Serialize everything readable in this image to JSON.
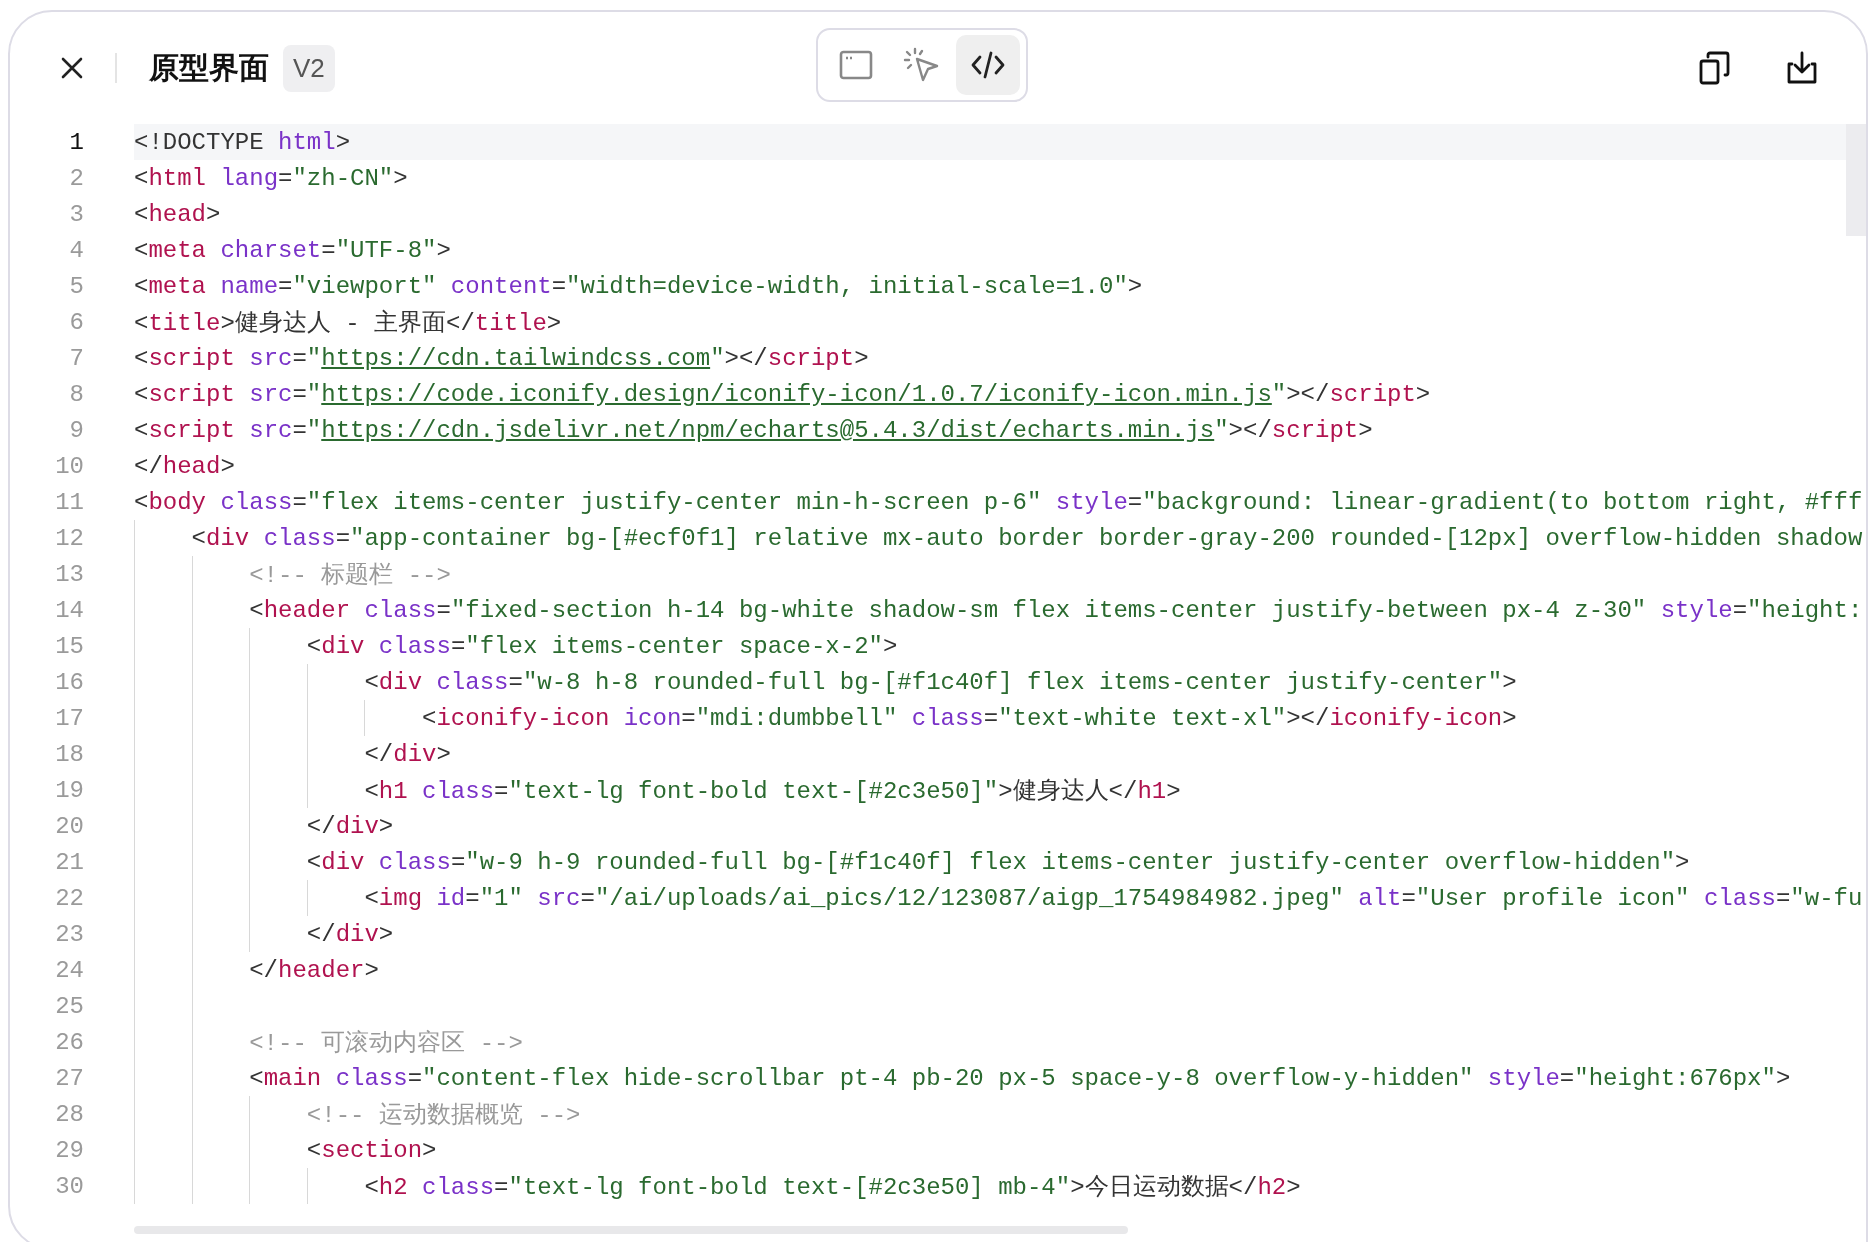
{
  "header": {
    "title": "原型界面",
    "version": "V2",
    "view_modes": [
      {
        "kind": "preview",
        "selected": false
      },
      {
        "kind": "select",
        "selected": false
      },
      {
        "kind": "code",
        "selected": true
      }
    ]
  },
  "editor": {
    "lines": [
      {
        "number": "1",
        "selected": true,
        "tokens": [
          {
            "kind": "punct",
            "text": "<!DOCTYPE"
          },
          {
            "kind": "attr",
            "text": " html"
          },
          {
            "kind": "punct",
            "text": ">"
          }
        ]
      },
      {
        "number": "2",
        "selected": false,
        "tokens": [
          {
            "kind": "punct",
            "text": "<"
          },
          {
            "kind": "tag",
            "text": "html"
          },
          {
            "kind": "attr",
            "text": " lang"
          },
          {
            "kind": "punct",
            "text": "="
          },
          {
            "kind": "string",
            "text": "\"zh-CN\""
          },
          {
            "kind": "punct",
            "text": ">"
          }
        ]
      },
      {
        "number": "3",
        "selected": false,
        "tokens": [
          {
            "kind": "punct",
            "text": "<"
          },
          {
            "kind": "tag",
            "text": "head"
          },
          {
            "kind": "punct",
            "text": ">"
          }
        ]
      },
      {
        "number": "4",
        "selected": false,
        "tokens": [
          {
            "kind": "punct",
            "text": "<"
          },
          {
            "kind": "tag",
            "text": "meta"
          },
          {
            "kind": "attr",
            "text": " charset"
          },
          {
            "kind": "punct",
            "text": "="
          },
          {
            "kind": "string",
            "text": "\"UTF-8\""
          },
          {
            "kind": "punct",
            "text": ">"
          }
        ]
      },
      {
        "number": "5",
        "selected": false,
        "tokens": [
          {
            "kind": "punct",
            "text": "<"
          },
          {
            "kind": "tag",
            "text": "meta"
          },
          {
            "kind": "attr",
            "text": " name"
          },
          {
            "kind": "punct",
            "text": "="
          },
          {
            "kind": "string",
            "text": "\"viewport\""
          },
          {
            "kind": "attr",
            "text": " content"
          },
          {
            "kind": "punct",
            "text": "="
          },
          {
            "kind": "string",
            "text": "\"width=device-width, initial-scale=1.0\""
          },
          {
            "kind": "punct",
            "text": ">"
          }
        ]
      },
      {
        "number": "6",
        "selected": false,
        "tokens": [
          {
            "kind": "punct",
            "text": "<"
          },
          {
            "kind": "tag",
            "text": "title"
          },
          {
            "kind": "punct",
            "text": ">健身达人 - 主界面</"
          },
          {
            "kind": "tag",
            "text": "title"
          },
          {
            "kind": "punct",
            "text": ">"
          }
        ]
      },
      {
        "number": "7",
        "selected": false,
        "tokens": [
          {
            "kind": "punct",
            "text": "<"
          },
          {
            "kind": "tag",
            "text": "script"
          },
          {
            "kind": "attr",
            "text": " src"
          },
          {
            "kind": "punct",
            "text": "="
          },
          {
            "kind": "string",
            "text": "\""
          },
          {
            "kind": "link",
            "text": "https://cdn.tailwindcss.com"
          },
          {
            "kind": "string",
            "text": "\""
          },
          {
            "kind": "punct",
            "text": "></"
          },
          {
            "kind": "tag",
            "text": "script"
          },
          {
            "kind": "punct",
            "text": ">"
          }
        ]
      },
      {
        "number": "8",
        "selected": false,
        "tokens": [
          {
            "kind": "punct",
            "text": "<"
          },
          {
            "kind": "tag",
            "text": "script"
          },
          {
            "kind": "attr",
            "text": " src"
          },
          {
            "kind": "punct",
            "text": "="
          },
          {
            "kind": "string",
            "text": "\""
          },
          {
            "kind": "link",
            "text": "https://code.iconify.design/iconify-icon/1.0.7/iconify-icon.min.js"
          },
          {
            "kind": "string",
            "text": "\""
          },
          {
            "kind": "punct",
            "text": "></"
          },
          {
            "kind": "tag",
            "text": "script"
          },
          {
            "kind": "punct",
            "text": ">"
          }
        ]
      },
      {
        "number": "9",
        "selected": false,
        "tokens": [
          {
            "kind": "punct",
            "text": "<"
          },
          {
            "kind": "tag",
            "text": "script"
          },
          {
            "kind": "attr",
            "text": " src"
          },
          {
            "kind": "punct",
            "text": "="
          },
          {
            "kind": "string",
            "text": "\""
          },
          {
            "kind": "link",
            "text": "https://cdn.jsdelivr.net/npm/echarts@5.4.3/dist/echarts.min.js"
          },
          {
            "kind": "string",
            "text": "\""
          },
          {
            "kind": "punct",
            "text": "></"
          },
          {
            "kind": "tag",
            "text": "script"
          },
          {
            "kind": "punct",
            "text": ">"
          }
        ]
      },
      {
        "number": "10",
        "selected": false,
        "tokens": [
          {
            "kind": "punct",
            "text": "</"
          },
          {
            "kind": "tag",
            "text": "head"
          },
          {
            "kind": "punct",
            "text": ">"
          }
        ]
      },
      {
        "number": "11",
        "selected": false,
        "tokens": [
          {
            "kind": "punct",
            "text": "<"
          },
          {
            "kind": "tag",
            "text": "body"
          },
          {
            "kind": "attr",
            "text": " class"
          },
          {
            "kind": "punct",
            "text": "="
          },
          {
            "kind": "string",
            "text": "\"flex items-center justify-center min-h-screen p-6\""
          },
          {
            "kind": "attr",
            "text": " style"
          },
          {
            "kind": "punct",
            "text": "="
          },
          {
            "kind": "string",
            "text": "\"background: linear-gradient(to bottom right, #fff"
          }
        ],
        "children": [
          {
            "number": "12",
            "selected": false,
            "tokens": [
              {
                "kind": "punct",
                "text": "<"
              },
              {
                "kind": "tag",
                "text": "div"
              },
              {
                "kind": "attr",
                "text": " class"
              },
              {
                "kind": "punct",
                "text": "="
              },
              {
                "kind": "string",
                "text": "\"app-container bg-[#ecf0f1] relative mx-auto border border-gray-200 rounded-[12px] overflow-hidden shadow"
              }
            ],
            "children": [
              {
                "number": "13",
                "selected": false,
                "tokens": [
                  {
                    "kind": "comment",
                    "text": "<!-- 标题栏 -->"
                  }
                ]
              },
              {
                "number": "14",
                "selected": false,
                "tokens": [
                  {
                    "kind": "punct",
                    "text": "<"
                  },
                  {
                    "kind": "tag",
                    "text": "header"
                  },
                  {
                    "kind": "attr",
                    "text": " class"
                  },
                  {
                    "kind": "punct",
                    "text": "="
                  },
                  {
                    "kind": "string",
                    "text": "\"fixed-section h-14 bg-white shadow-sm flex items-center justify-between px-4 z-30\""
                  },
                  {
                    "kind": "attr",
                    "text": " style"
                  },
                  {
                    "kind": "punct",
                    "text": "="
                  },
                  {
                    "kind": "string",
                    "text": "\"height:"
                  }
                ],
                "children": [
                  {
                    "number": "15",
                    "selected": false,
                    "tokens": [
                      {
                        "kind": "punct",
                        "text": "<"
                      },
                      {
                        "kind": "tag",
                        "text": "div"
                      },
                      {
                        "kind": "attr",
                        "text": " class"
                      },
                      {
                        "kind": "punct",
                        "text": "="
                      },
                      {
                        "kind": "string",
                        "text": "\"flex items-center space-x-2\""
                      },
                      {
                        "kind": "punct",
                        "text": ">"
                      }
                    ],
                    "children": [
                      {
                        "number": "16",
                        "selected": false,
                        "tokens": [
                          {
                            "kind": "punct",
                            "text": "<"
                          },
                          {
                            "kind": "tag",
                            "text": "div"
                          },
                          {
                            "kind": "attr",
                            "text": " class"
                          },
                          {
                            "kind": "punct",
                            "text": "="
                          },
                          {
                            "kind": "string",
                            "text": "\"w-8 h-8 rounded-full bg-[#f1c40f] flex items-center justify-center\""
                          },
                          {
                            "kind": "punct",
                            "text": ">"
                          }
                        ],
                        "children": [
                          {
                            "number": "17",
                            "selected": false,
                            "tokens": [
                              {
                                "kind": "punct",
                                "text": "<"
                              },
                              {
                                "kind": "tag",
                                "text": "iconify-icon"
                              },
                              {
                                "kind": "attr",
                                "text": " icon"
                              },
                              {
                                "kind": "punct",
                                "text": "="
                              },
                              {
                                "kind": "string",
                                "text": "\"mdi:dumbbell\""
                              },
                              {
                                "kind": "attr",
                                "text": " class"
                              },
                              {
                                "kind": "punct",
                                "text": "="
                              },
                              {
                                "kind": "string",
                                "text": "\"text-white text-xl\""
                              },
                              {
                                "kind": "punct",
                                "text": "></"
                              },
                              {
                                "kind": "tag",
                                "text": "iconify-icon"
                              },
                              {
                                "kind": "punct",
                                "text": ">"
                              }
                            ]
                          }
                        ]
                      },
                      {
                        "number": "18",
                        "selected": false,
                        "tokens": [
                          {
                            "kind": "punct",
                            "text": "</"
                          },
                          {
                            "kind": "tag",
                            "text": "div"
                          },
                          {
                            "kind": "punct",
                            "text": ">"
                          }
                        ]
                      },
                      {
                        "number": "19",
                        "selected": false,
                        "tokens": [
                          {
                            "kind": "punct",
                            "text": "<"
                          },
                          {
                            "kind": "tag",
                            "text": "h1"
                          },
                          {
                            "kind": "attr",
                            "text": " class"
                          },
                          {
                            "kind": "punct",
                            "text": "="
                          },
                          {
                            "kind": "string",
                            "text": "\"text-lg font-bold text-[#2c3e50]\""
                          },
                          {
                            "kind": "punct",
                            "text": ">健身达人</"
                          },
                          {
                            "kind": "tag",
                            "text": "h1"
                          },
                          {
                            "kind": "punct",
                            "text": ">"
                          }
                        ]
                      }
                    ]
                  },
                  {
                    "number": "20",
                    "selected": false,
                    "tokens": [
                      {
                        "kind": "punct",
                        "text": "</"
                      },
                      {
                        "kind": "tag",
                        "text": "div"
                      },
                      {
                        "kind": "punct",
                        "text": ">"
                      }
                    ]
                  },
                  {
                    "number": "21",
                    "selected": false,
                    "tokens": [
                      {
                        "kind": "punct",
                        "text": "<"
                      },
                      {
                        "kind": "tag",
                        "text": "div"
                      },
                      {
                        "kind": "attr",
                        "text": " class"
                      },
                      {
                        "kind": "punct",
                        "text": "="
                      },
                      {
                        "kind": "string",
                        "text": "\"w-9 h-9 rounded-full bg-[#f1c40f] flex items-center justify-center overflow-hidden\""
                      },
                      {
                        "kind": "punct",
                        "text": ">"
                      }
                    ],
                    "children": [
                      {
                        "number": "22",
                        "selected": false,
                        "tokens": [
                          {
                            "kind": "punct",
                            "text": "<"
                          },
                          {
                            "kind": "tag",
                            "text": "img"
                          },
                          {
                            "kind": "attr",
                            "text": " id"
                          },
                          {
                            "kind": "punct",
                            "text": "="
                          },
                          {
                            "kind": "string",
                            "text": "\"1\""
                          },
                          {
                            "kind": "attr",
                            "text": " src"
                          },
                          {
                            "kind": "punct",
                            "text": "="
                          },
                          {
                            "kind": "string",
                            "text": "\"/ai/uploads/ai_pics/12/123087/aigp_1754984982.jpeg\""
                          },
                          {
                            "kind": "attr",
                            "text": " alt"
                          },
                          {
                            "kind": "punct",
                            "text": "="
                          },
                          {
                            "kind": "string",
                            "text": "\"User profile icon\""
                          },
                          {
                            "kind": "attr",
                            "text": " class"
                          },
                          {
                            "kind": "punct",
                            "text": "="
                          },
                          {
                            "kind": "string",
                            "text": "\"w-fu"
                          }
                        ]
                      }
                    ]
                  },
                  {
                    "number": "23",
                    "selected": false,
                    "tokens": [
                      {
                        "kind": "punct",
                        "text": "</"
                      },
                      {
                        "kind": "tag",
                        "text": "div"
                      },
                      {
                        "kind": "punct",
                        "text": ">"
                      }
                    ]
                  }
                ]
              },
              {
                "number": "24",
                "selected": false,
                "tokens": [
                  {
                    "kind": "punct",
                    "text": "</"
                  },
                  {
                    "kind": "tag",
                    "text": "header"
                  },
                  {
                    "kind": "punct",
                    "text": ">"
                  }
                ]
              },
              {
                "number": "25",
                "selected": false
              },
              {
                "number": "26",
                "selected": false,
                "tokens": [
                  {
                    "kind": "comment",
                    "text": "<!-- 可滚动内容区 -->"
                  }
                ]
              },
              {
                "number": "27",
                "selected": false,
                "tokens": [
                  {
                    "kind": "punct",
                    "text": "<"
                  },
                  {
                    "kind": "tag",
                    "text": "main"
                  },
                  {
                    "kind": "attr",
                    "text": " class"
                  },
                  {
                    "kind": "punct",
                    "text": "="
                  },
                  {
                    "kind": "string",
                    "text": "\"content-flex hide-scrollbar pt-4 pb-20 px-5 space-y-8 overflow-y-hidden\""
                  },
                  {
                    "kind": "attr",
                    "text": " style"
                  },
                  {
                    "kind": "punct",
                    "text": "="
                  },
                  {
                    "kind": "string",
                    "text": "\"height:676px\""
                  },
                  {
                    "kind": "punct",
                    "text": ">"
                  }
                ],
                "children": [
                  {
                    "number": "28",
                    "selected": false,
                    "tokens": [
                      {
                        "kind": "comment",
                        "text": "<!-- 运动数据概览 -->"
                      }
                    ]
                  },
                  {
                    "number": "29",
                    "selected": false,
                    "tokens": [
                      {
                        "kind": "punct",
                        "text": "<"
                      },
                      {
                        "kind": "tag",
                        "text": "section"
                      },
                      {
                        "kind": "punct",
                        "text": ">"
                      }
                    ],
                    "children": [
                      {
                        "number": "30",
                        "selected": false,
                        "tokens": [
                          {
                            "kind": "punct",
                            "text": "<"
                          },
                          {
                            "kind": "tag",
                            "text": "h2"
                          },
                          {
                            "kind": "attr",
                            "text": " class"
                          },
                          {
                            "kind": "punct",
                            "text": "="
                          },
                          {
                            "kind": "string",
                            "text": "\"text-lg font-bold text-[#2c3e50] mb-4\""
                          },
                          {
                            "kind": "punct",
                            "text": ">今日运动数据</"
                          },
                          {
                            "kind": "tag",
                            "text": "h2"
                          },
                          {
                            "kind": "punct",
                            "text": ">"
                          }
                        ]
                      }
                    ]
                  }
                ]
              }
            ]
          }
        ]
      }
    ]
  }
}
